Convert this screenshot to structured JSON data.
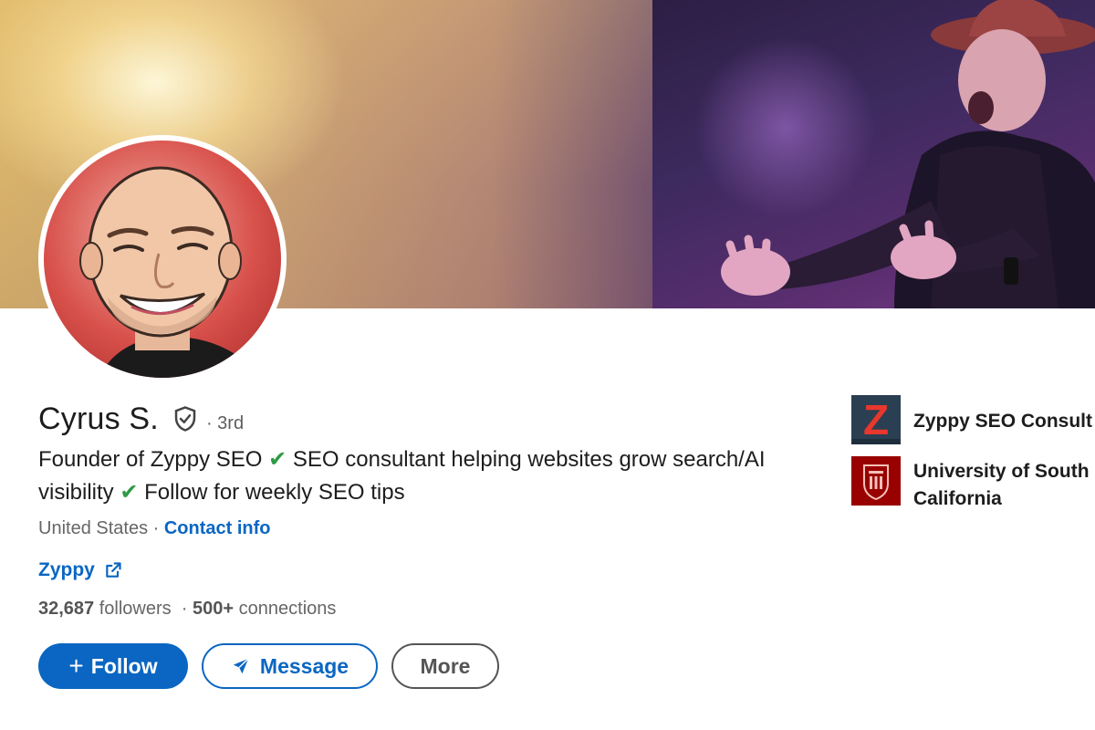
{
  "profile": {
    "name": "Cyrus S.",
    "degree": "· 3rd",
    "headline_part1": "Founder of Zyppy SEO",
    "headline_part2": "SEO consultant helping websites grow search/AI visibility",
    "headline_part3": "Follow for weekly SEO tips",
    "check_glyph": "✔",
    "location": "United States ·",
    "contact_info_label": "Contact info",
    "website_label": "Zyppy",
    "followers_count": "32,687",
    "followers_label": "followers",
    "stats_separator": "·",
    "connections_count": "500+",
    "connections_label": "connections"
  },
  "actions": {
    "follow_plus": "+",
    "follow_label": "Follow",
    "message_label": "Message",
    "more_label": "More"
  },
  "organizations": [
    {
      "name": "Zyppy SEO Consult",
      "logo_letter": "Z",
      "icon": "zyppy-logo"
    },
    {
      "name": "University of South California",
      "icon": "usc-seal"
    }
  ],
  "colors": {
    "link_blue": "#0a66c2",
    "check_green": "#2e9a45",
    "avatar_red": "#d8504a"
  },
  "icons": {
    "verified": "shield-check-icon",
    "external_link": "external-link-icon",
    "send": "paper-plane-icon"
  }
}
